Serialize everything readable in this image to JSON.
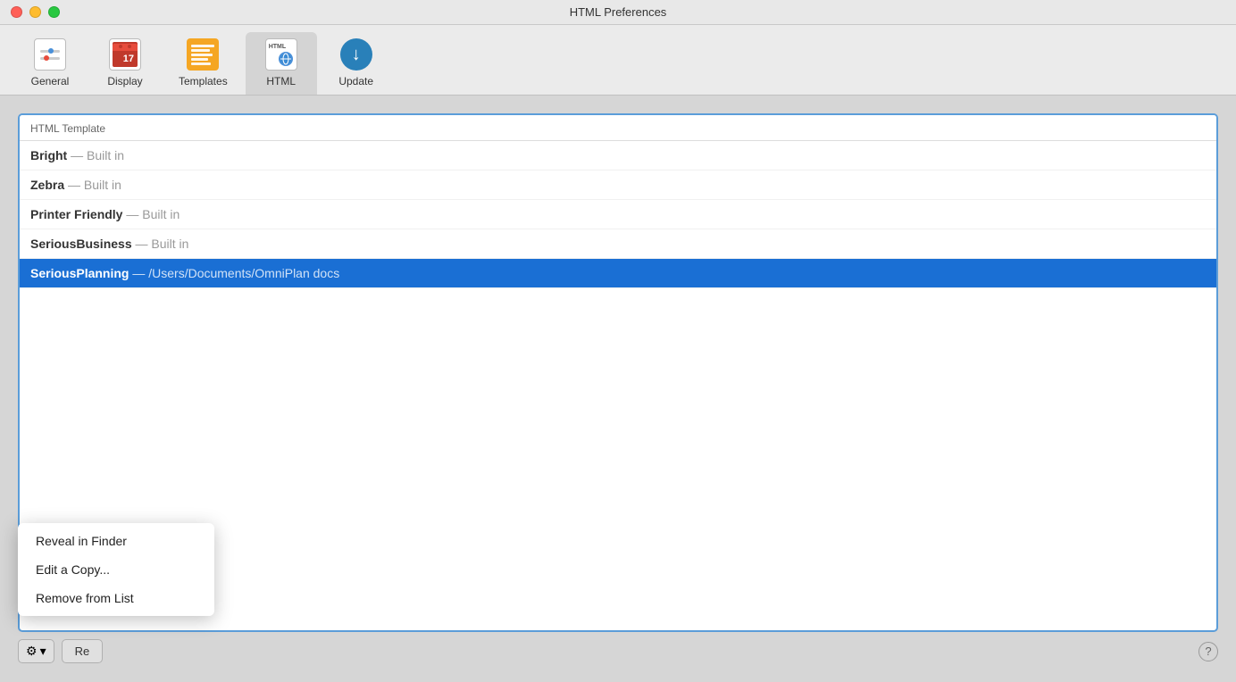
{
  "window": {
    "title": "HTML Preferences"
  },
  "toolbar": {
    "items": [
      {
        "id": "general",
        "label": "General",
        "icon": "general-icon"
      },
      {
        "id": "display",
        "label": "Display",
        "icon": "display-icon"
      },
      {
        "id": "templates",
        "label": "Templates",
        "icon": "templates-icon"
      },
      {
        "id": "html",
        "label": "HTML",
        "icon": "html-icon",
        "active": true
      },
      {
        "id": "update",
        "label": "Update",
        "icon": "update-icon"
      }
    ]
  },
  "list": {
    "header": "HTML Template",
    "items": [
      {
        "name": "Bright",
        "suffix": "— Built in",
        "selected": false
      },
      {
        "name": "Zebra",
        "suffix": "— Built in",
        "selected": false
      },
      {
        "name": "Printer Friendly",
        "suffix": "— Built in",
        "selected": false
      },
      {
        "name": "SeriousBusiness",
        "suffix": "— Built in",
        "selected": false
      },
      {
        "name": "SeriousPlanning",
        "suffix": "— /Users/Documents/OmniPlan docs",
        "selected": true
      }
    ]
  },
  "actions_button": {
    "gear_symbol": "⚙",
    "chevron_symbol": "▾"
  },
  "dropdown": {
    "items": [
      {
        "id": "reveal",
        "label": "Reveal in Finder"
      },
      {
        "id": "edit",
        "label": "Edit a Copy..."
      },
      {
        "id": "remove",
        "label": "Remove from List"
      }
    ]
  },
  "bottom": {
    "restore_label": "Re",
    "help_label": "?"
  }
}
